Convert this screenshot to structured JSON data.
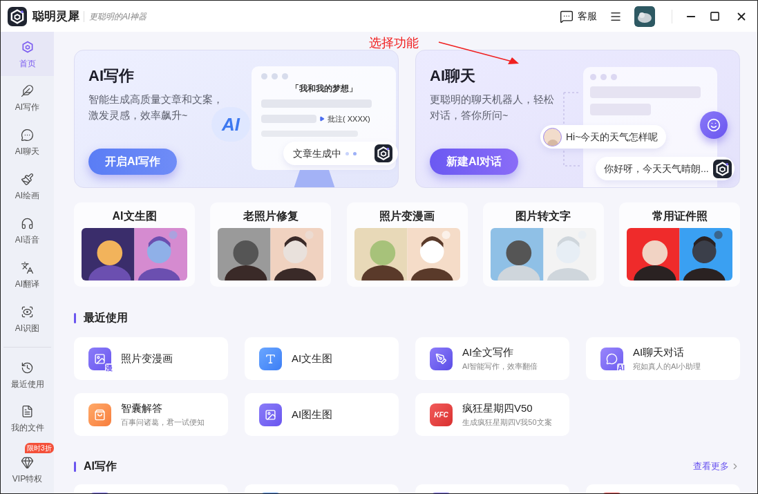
{
  "app": {
    "name": "聪明灵犀",
    "slogan": "更聪明的AI神器"
  },
  "header": {
    "service": "客服"
  },
  "sidebar": {
    "items": [
      {
        "label": "首页",
        "selected": true
      },
      {
        "label": "AI写作",
        "selected": false
      },
      {
        "label": "AI聊天",
        "selected": false
      },
      {
        "label": "AI绘画",
        "selected": false
      },
      {
        "label": "AI语音",
        "selected": false
      },
      {
        "label": "AI翻译",
        "selected": false
      },
      {
        "label": "AI识图",
        "selected": false
      }
    ],
    "bottom": [
      {
        "label": "最近使用"
      },
      {
        "label": "我的文件"
      },
      {
        "label": "VIP特权",
        "badge": "限时3折"
      }
    ]
  },
  "annotation": "选择功能",
  "heroes": [
    {
      "kind": "writing",
      "title": "AI写作",
      "lines": [
        "智能生成高质量文章和文案，",
        "激发灵感，效率飙升~"
      ],
      "button": "开启AI写作",
      "doc_title": "「我和我的梦想」",
      "note": "批注( XXXX)",
      "logo": "AI",
      "status": "文章生成中"
    },
    {
      "kind": "chat",
      "title": "AI聊天",
      "lines": [
        "更聪明的聊天机器人，轻松",
        "对话，答你所问~"
      ],
      "button": "新建AI对话",
      "question": "Hi~今天的天气怎样呢",
      "answer": "你好呀，今天天气晴朗..."
    }
  ],
  "tiles": [
    {
      "title": "AI文生图"
    },
    {
      "title": "老照片修复"
    },
    {
      "title": "照片变漫画"
    },
    {
      "title": "图片转文字"
    },
    {
      "title": "常用证件照"
    }
  ],
  "recent": {
    "title": "最近使用",
    "items": [
      {
        "title": "照片变漫画",
        "kind": "comic",
        "icon_text": "漫"
      },
      {
        "title": "AI文生图",
        "kind": "txt2img"
      },
      {
        "title": "AI全文写作",
        "subtitle": "AI智能写作，效率翻倍",
        "kind": "write"
      },
      {
        "title": "AI聊天对话",
        "subtitle": "宛如真人的AI小助理",
        "kind": "chat",
        "icon_text": "AI"
      },
      {
        "title": "智囊解答",
        "subtitle": "百事问诸葛，君一试便知",
        "kind": "bag"
      },
      {
        "title": "AI图生图",
        "kind": "img2img"
      },
      {
        "title": "疯狂星期四V50",
        "subtitle": "生成疯狂星期四V我50文案",
        "kind": "kfc",
        "icon_text": "KFC"
      }
    ]
  },
  "writing_section": {
    "title": "AI写作",
    "more": "查看更多",
    "cards": [
      {
        "kind": "write"
      },
      {
        "kind": "txt2img"
      },
      {
        "kind": "img2img"
      },
      {
        "kind": "kfc"
      }
    ]
  }
}
